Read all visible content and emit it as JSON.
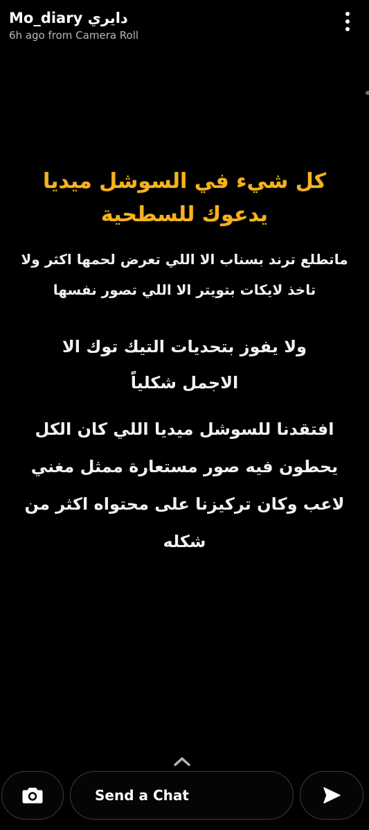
{
  "header": {
    "username": "Mo_diary دايري",
    "subtitle": "6h ago from Camera Roll",
    "menu_icon": "more-vertical-icon"
  },
  "story": {
    "title_lines": [
      "كل شيء في السوشل ميديا",
      "يدعوك للسطحية"
    ],
    "paragraph1": [
      "ماتطلع ترند بسناب الا اللي تعرض لحمها اكثر ولا",
      "تاخذ لايكات بتويتر الا اللي تصور نفسها"
    ],
    "paragraph2": [
      "ولا يفوز بتحديات التيك توك الا",
      "الاجمل شكلياً"
    ],
    "paragraph3": [
      "افتقدنا للسوشل ميديا اللي كان الكل",
      "يحطون فيه صور مستعارة ممثل مغني",
      "لاعب وكان تركيزنا على محتواه اكثر من",
      "شكله"
    ],
    "colors": {
      "title": "#f6b21f",
      "body": "#f1f1f1"
    }
  },
  "footer": {
    "swipe_up_icon": "chevron-up-icon",
    "camera_icon": "camera-icon",
    "chat_placeholder": "Send a Chat",
    "send_icon": "send-arrow-icon"
  }
}
